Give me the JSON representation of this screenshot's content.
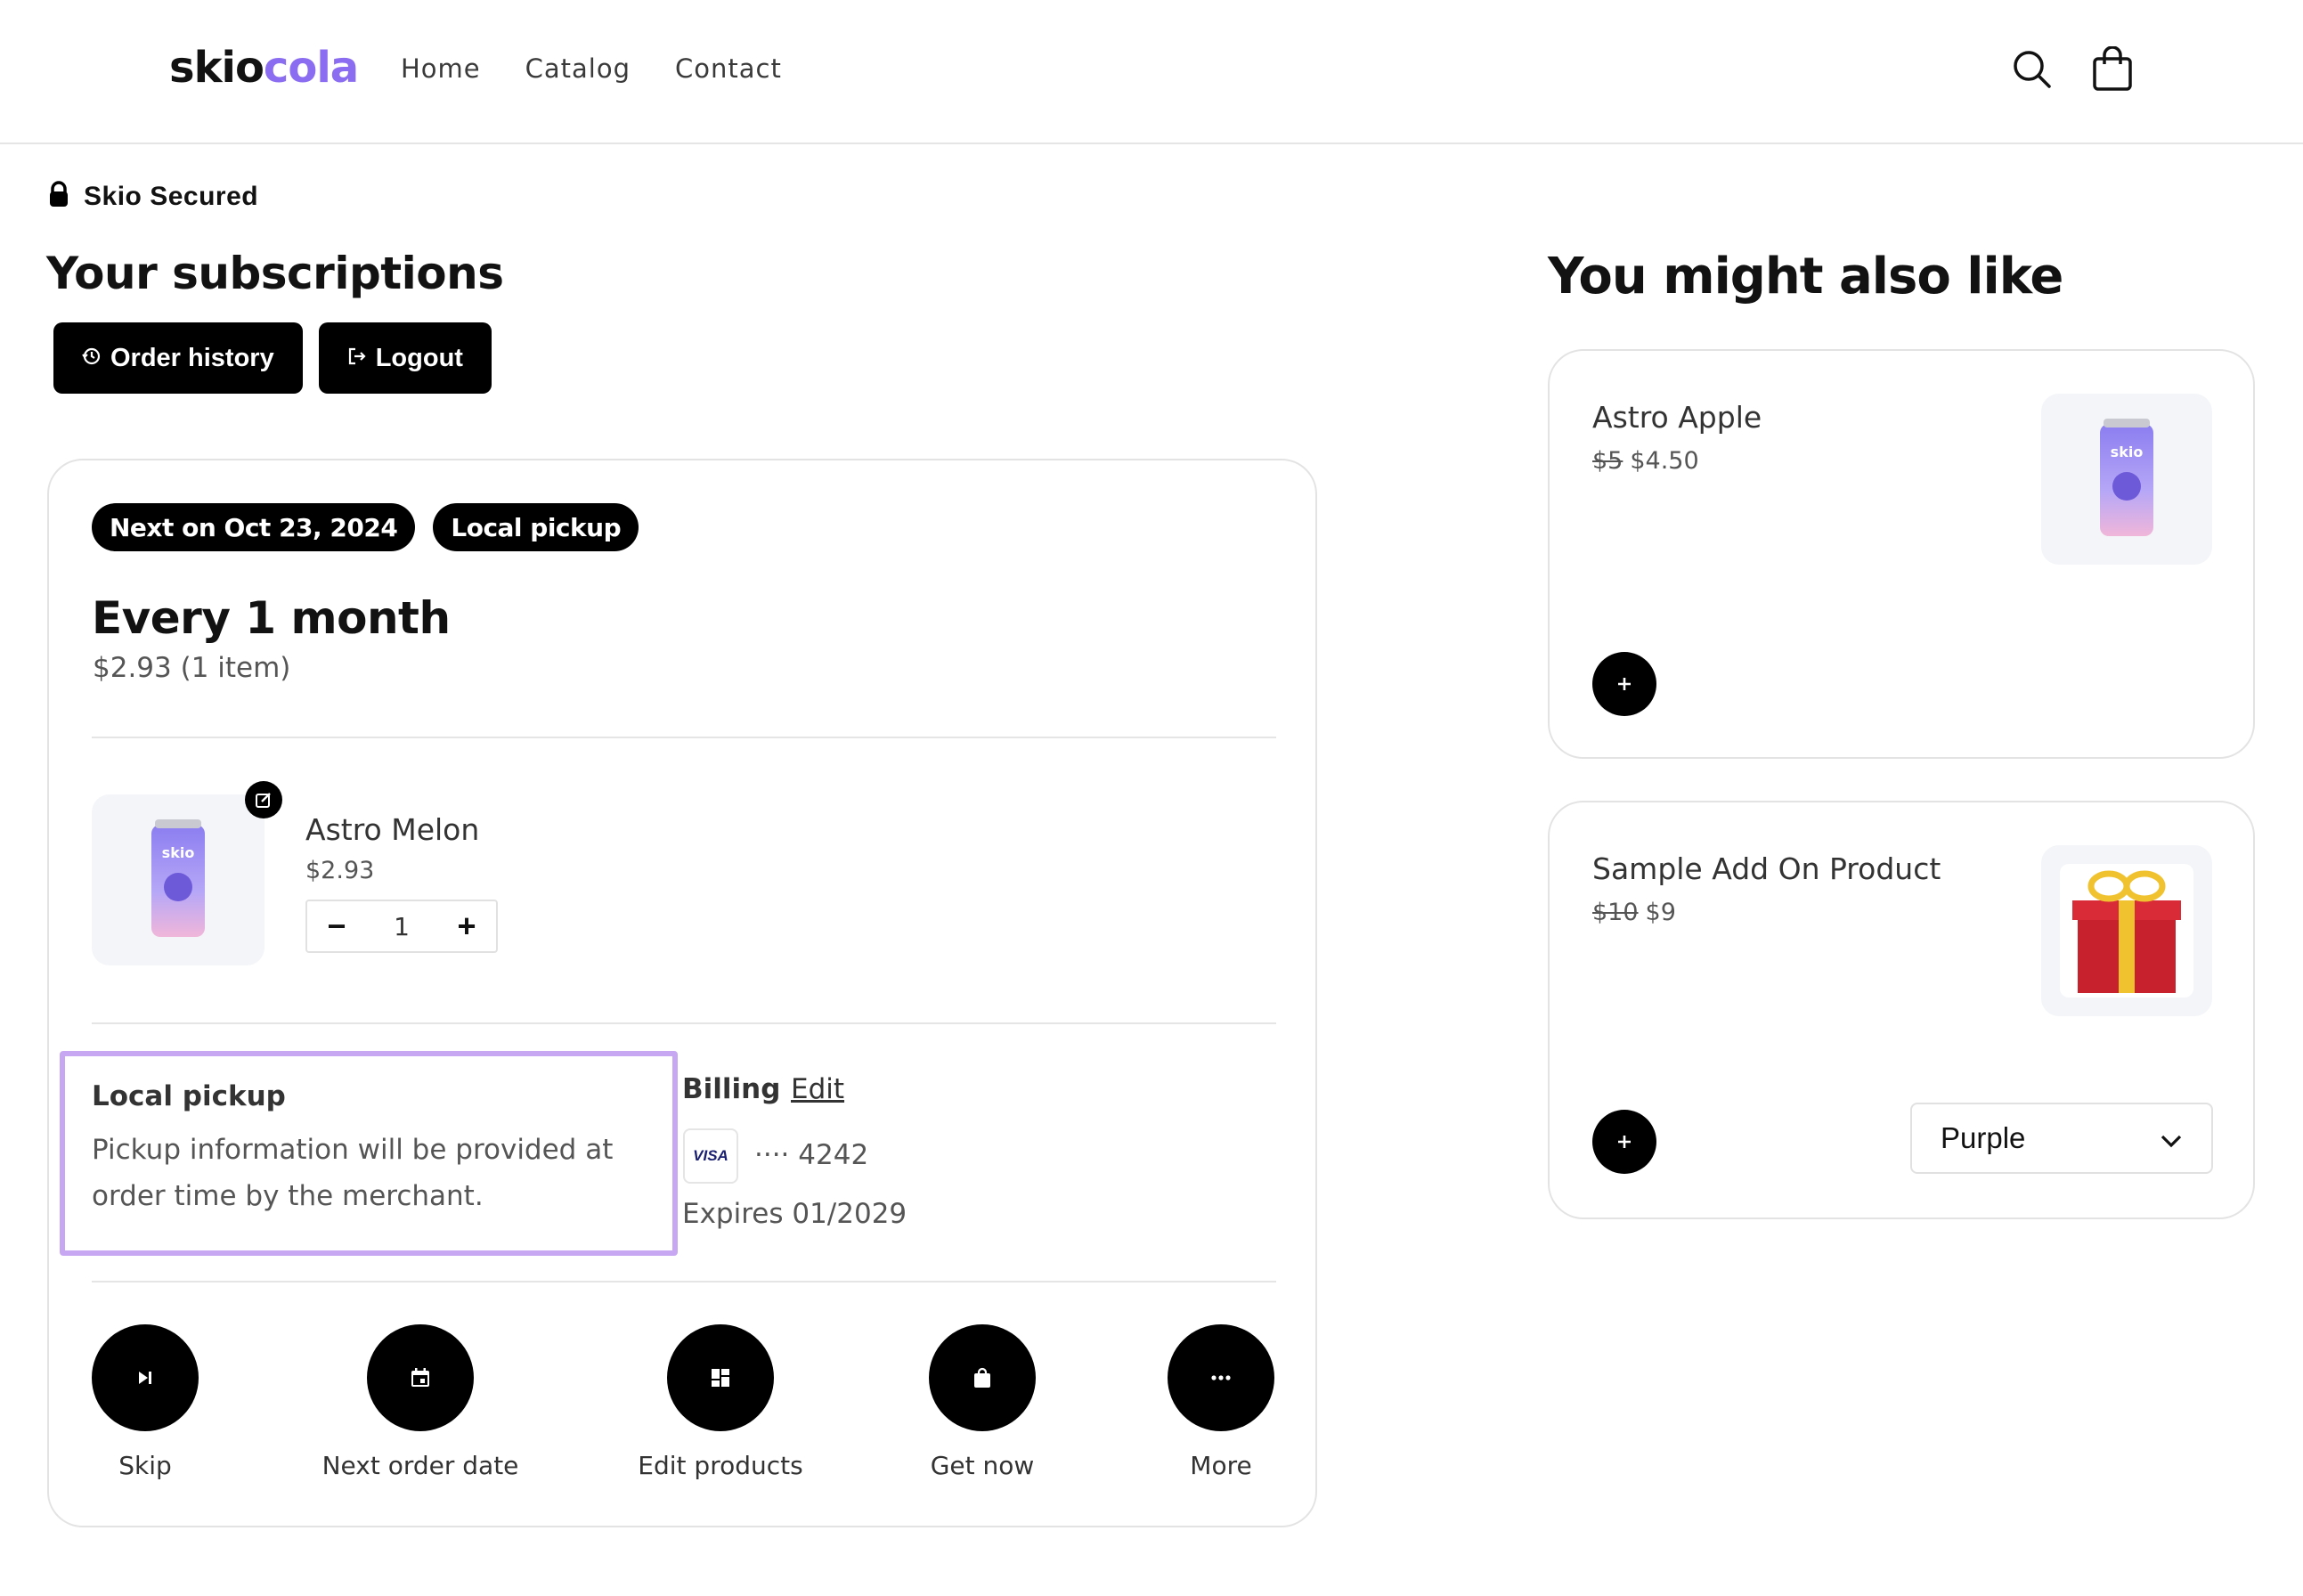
{
  "header": {
    "logo_part1": "skio",
    "logo_part2": "cola",
    "nav": [
      "Home",
      "Catalog",
      "Contact"
    ],
    "search_icon": "search-icon",
    "cart_icon": "cart-icon"
  },
  "secured": {
    "label": "Skio Secured",
    "icon": "lock-icon"
  },
  "page_title": "Your subscriptions",
  "buttons": {
    "order_history": "Order history",
    "logout": "Logout"
  },
  "subscription": {
    "badges": [
      "Next on Oct 23, 2024",
      "Local pickup"
    ],
    "frequency": "Every 1 month",
    "price_summary": "$2.93 (1 item)",
    "product": {
      "name": "Astro Melon",
      "price": "$2.93",
      "quantity": "1",
      "minus": "−",
      "plus": "+"
    },
    "pickup": {
      "title": "Local pickup",
      "text": "Pickup information will be provided at order time by the merchant."
    },
    "billing": {
      "title": "Billing",
      "edit": "Edit",
      "card_brand": "VISA",
      "card_number": "···· 4242",
      "expires": "Expires 01/2029"
    },
    "actions": [
      {
        "label": "Skip",
        "icon": "skip-icon"
      },
      {
        "label": "Next order date",
        "icon": "calendar-icon"
      },
      {
        "label": "Edit products",
        "icon": "grid-icon"
      },
      {
        "label": "Get now",
        "icon": "bag-icon"
      },
      {
        "label": "More",
        "icon": "more-icon"
      }
    ]
  },
  "recommendations": {
    "title": "You might also like",
    "items": [
      {
        "name": "Astro Apple",
        "old_price": "$5",
        "price": "$4.50"
      },
      {
        "name": "Sample Add On Product",
        "old_price": "$10",
        "price": "$9",
        "variant": "Purple"
      }
    ]
  },
  "colors": {
    "brand_purple": "#8a6df1",
    "highlight": "#c7a7f2"
  }
}
